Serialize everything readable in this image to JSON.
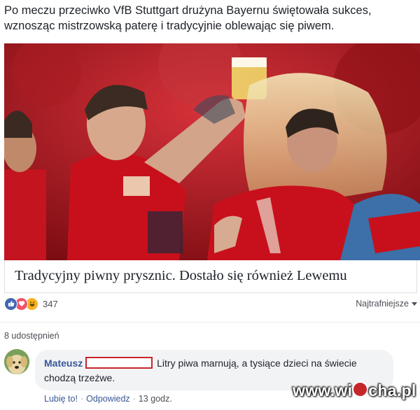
{
  "post": {
    "text": "Po meczu przeciwko VfB Stuttgart drużyna Bayernu świętowała sukces, wznosząc mistrzowską paterę i tradycyjnie oblewając się piwem."
  },
  "link_card": {
    "caption": "Tradycyjny piwny prysznic. Dostało się również Lewemu",
    "photo_icon": "photo-players-beer-shower"
  },
  "reactions": {
    "icons": [
      "like-icon",
      "love-icon",
      "haha-icon"
    ],
    "count": "347"
  },
  "sort": {
    "label": "Najtrafniejsze"
  },
  "shares": {
    "label": "8 udostępnień"
  },
  "comment": {
    "author": "Mateusz",
    "text": "Litry piwa marnują, a tysiące dzieci na świecie chodzą trzeźwe.",
    "like_label": "Lubię to!",
    "reply_label": "Odpowiedz",
    "time": "13 godz.",
    "avatar_icon": "dog-avatar"
  },
  "watermark": {
    "text_before": "www.wi",
    "text_after": "cha.pl"
  },
  "colors": {
    "link": "#385898",
    "bayern_red": "#b9121b",
    "like_blue": "#4267b2",
    "love_red": "#f25268",
    "haha_yellow": "#f7b125",
    "redaction": "#c6262a"
  }
}
